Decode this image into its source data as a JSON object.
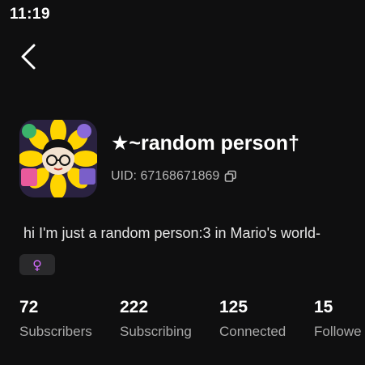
{
  "status_bar": {
    "time": "11:19"
  },
  "profile": {
    "name": "★~random person†",
    "uid": "UID: 67168671869",
    "bio": "hi I'm just a random person:3 in Mario's world-",
    "gender_symbol": "♀"
  },
  "stats": [
    {
      "value": "72",
      "label": "Subscribers"
    },
    {
      "value": "222",
      "label": "Subscribing"
    },
    {
      "value": "125",
      "label": "Connected"
    },
    {
      "value": "15",
      "label": "Followe"
    }
  ],
  "icons": {
    "back": "chevron-left-icon",
    "copy": "copy-icon"
  },
  "colors": {
    "background": "#0f0f10",
    "gender_accent": "#d46bff"
  }
}
